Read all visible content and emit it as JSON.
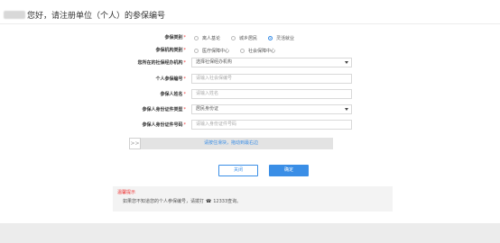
{
  "header": {
    "title": "您好，请注册单位（个人）的参保编号"
  },
  "form": {
    "insured_type": {
      "label": "参保类别",
      "options": [
        "离人基论",
        "城乡居民",
        "灵活就业"
      ],
      "selected_index": 2
    },
    "insured_institution_type": {
      "label": "参保机构类别",
      "options": [
        "医疗保障中心",
        "社会保障中心"
      ],
      "selected_index": -1
    },
    "institution": {
      "label": "您所在的社保经办机构",
      "value": "选择社保经办机构"
    },
    "personal_number": {
      "label": "个人参保编号",
      "placeholder": "请输入社会保编号"
    },
    "name": {
      "label": "参保人姓名",
      "placeholder": "请输入姓名"
    },
    "id_type": {
      "label": "参保人身份证件类型",
      "value": "居民身份证"
    },
    "id_number": {
      "label": "参保人身份证件号码",
      "placeholder": "请输入身份证件号码"
    },
    "required_mark": "*"
  },
  "slider": {
    "handle_glyph": ">>",
    "text": "请按住滑块，拖动到最右边"
  },
  "buttons": {
    "cancel": "关闭",
    "confirm": "确定"
  },
  "tips": {
    "title": "温馨提示",
    "body_before": "如果您不知道您的个人参保编号，请拨打",
    "phone": "12333",
    "body_after": "查询。"
  },
  "colors": {
    "accent": "#3a8ee6",
    "required": "#e33333"
  }
}
